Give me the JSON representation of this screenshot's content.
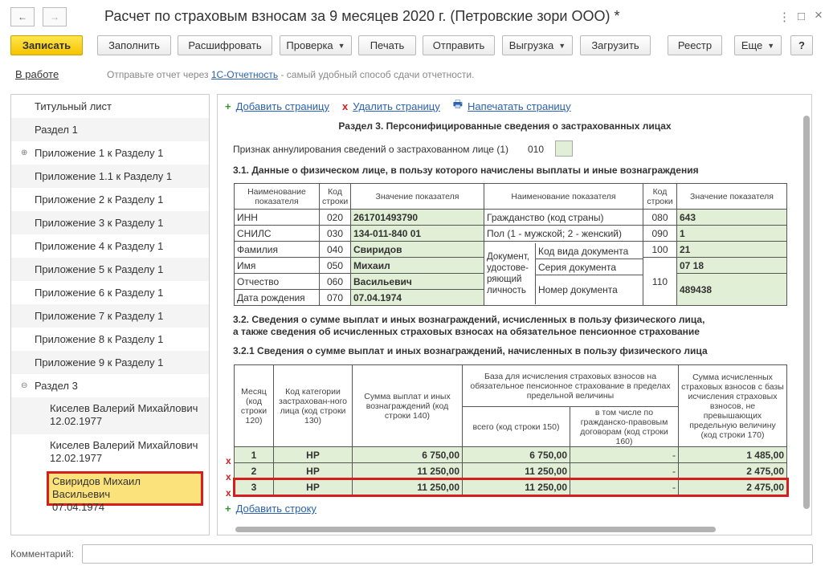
{
  "window": {
    "title": "Расчет по страховым взносам за 9 месяцев 2020 г. (Петровские зори ООО) *",
    "back_icon": "←",
    "forward_icon": "→",
    "more_icon": "⋮",
    "fullscreen_icon": "□",
    "close_icon": "×"
  },
  "toolbar": {
    "save": "Записать",
    "fill": "Заполнить",
    "decode": "Расшифровать",
    "check": "Проверка",
    "print": "Печать",
    "send": "Отправить",
    "export": "Выгрузка",
    "import": "Загрузить",
    "registry": "Реестр",
    "more": "Еще",
    "help": "?"
  },
  "status": {
    "state": "В работе",
    "msg_prefix": "Отправьте отчет через",
    "msg_link": "1С-Отчетность",
    "msg_suffix": "- самый удобный способ сдачи отчетности."
  },
  "tree": {
    "items": [
      "Титульный лист",
      "Раздел 1",
      "Приложение 1 к Разделу 1",
      "Приложение 1.1 к Разделу 1",
      "Приложение 2 к Разделу 1",
      "Приложение 3 к Разделу 1",
      "Приложение 4 к Разделу 1",
      "Приложение 5 к Разделу 1",
      "Приложение 6 к Разделу 1",
      "Приложение 7 к Разделу 1",
      "Приложение 8 к Разделу 1",
      "Приложение 9 к Разделу 1",
      "Раздел 3"
    ],
    "expand_icon": "⊕",
    "collapse_icon": "⊖",
    "persons": [
      {
        "name": "Киселев Валерий Михайлович",
        "date": "12.02.1977"
      },
      {
        "name": "Киселев Валерий Михайлович",
        "date": "12.02.1977"
      },
      {
        "name": "Свиридов Михаил Васильевич",
        "date": "07.04.1974"
      }
    ]
  },
  "actions": {
    "add_page": "Добавить страницу",
    "delete_page": "Удалить страницу",
    "print_page": "Напечатать страницу",
    "plus_icon": "+",
    "x_icon": "x",
    "printer_icon": "🖶"
  },
  "form": {
    "section_title": "Раздел 3. Персонифицированные сведения о застрахованных лицах",
    "annul_label": "Признак аннулирования сведений о застрахованном лице (1)",
    "annul_code": "010",
    "s31_title": "3.1. Данные о физическом лице, в пользу которого начислены выплаты и иные вознаграждения",
    "t1_headers": {
      "name": "Наименование показателя",
      "code": "Код строки",
      "value": "Значение показателя",
      "name2": "Наименование показателя",
      "code2": "Код строки",
      "value2": "Значение показателя"
    },
    "t1_left": [
      {
        "label": "ИНН",
        "code": "020",
        "value": "261701493790"
      },
      {
        "label": "СНИЛС",
        "code": "030",
        "value": "134-011-840 01"
      },
      {
        "label": "Фамилия",
        "code": "040",
        "value": "Свиридов"
      },
      {
        "label": "Имя",
        "code": "050",
        "value": "Михаил"
      },
      {
        "label": "Отчество",
        "code": "060",
        "value": "Васильевич"
      },
      {
        "label": "Дата рождения",
        "code": "070",
        "value": "07.04.1974"
      }
    ],
    "t1_right": {
      "citizenship_label": "Гражданство (код страны)",
      "citizenship_code": "080",
      "citizenship_value": "643",
      "gender_label": "Пол (1 - мужской; 2 - женский)",
      "gender_code": "090",
      "gender_value": "1",
      "doc_group": "Документ, удостове-ряющий личность",
      "doc_type_label": "Код вида документа",
      "doc_type_code": "100",
      "doc_type_value": "21",
      "doc_series_label": "Серия документа",
      "doc_number_label": "Номер документа",
      "doc_code": "110",
      "doc_series_value": "07 18",
      "doc_number_value": "489438"
    },
    "s32_title_1": "3.2. Сведения о сумме выплат и иных вознаграждений, исчисленных в пользу физического лица,",
    "s32_title_2": "а также сведения об исчисленных страховых взносах на обязательное пенсионное страхование",
    "s321_title": "3.2.1 Сведения о сумме выплат и иных вознаграждений, начисленных в пользу физического лица",
    "t2_headers": {
      "month": "Месяц (код строки 120)",
      "category": "Код категории застрахован-ного лица (код строки 130)",
      "amount": "Сумма выплат и иных вознаграждений (код строки 140)",
      "base": "База для исчисления страховых взносов на обязательное пенсионное страхование в пределах предельной величины",
      "base_total": "всего (код строки 150)",
      "base_civil": "в том числе по гражданско-правовым договорам (код строки 160)",
      "contrib": "Сумма исчисленных страховых взносов с базы исчисления страховых взносов, не превышающих предельную величину (код строки 170)"
    },
    "t2_rows": [
      {
        "month": "1",
        "category": "НР",
        "amount": "6 750,00",
        "base_total": "6 750,00",
        "base_civil": "-",
        "contrib": "1 485,00"
      },
      {
        "month": "2",
        "category": "НР",
        "amount": "11 250,00",
        "base_total": "11 250,00",
        "base_civil": "-",
        "contrib": "2 475,00"
      },
      {
        "month": "3",
        "category": "НР",
        "amount": "11 250,00",
        "base_total": "11 250,00",
        "base_civil": "-",
        "contrib": "2 475,00"
      }
    ],
    "add_row": "Добавить строку"
  },
  "comment": {
    "label": "Комментарий:",
    "value": ""
  },
  "colors": {
    "accent_yellow": "#f5c400",
    "selection": "#fbe27a",
    "highlight_red": "#d71d1d",
    "field_green": "#e2efd7",
    "link_blue": "#2a62b0"
  }
}
